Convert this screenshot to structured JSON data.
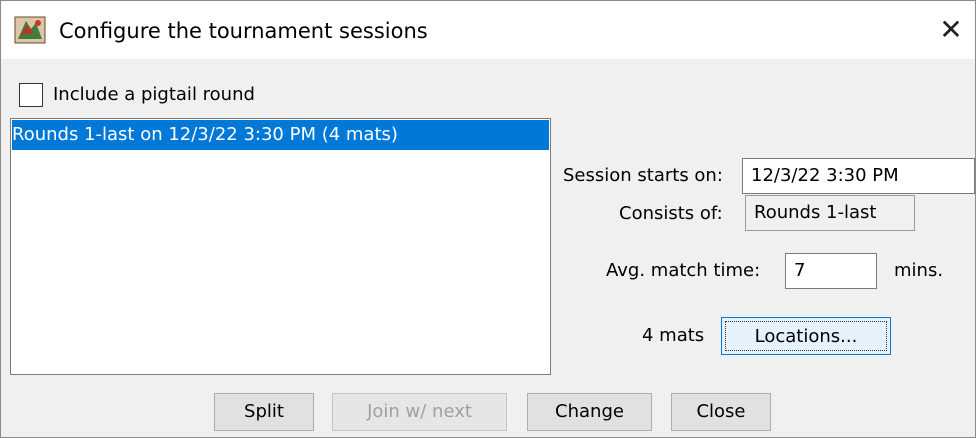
{
  "window": {
    "title": "Configure the tournament sessions",
    "close_glyph": "✕"
  },
  "pigtail": {
    "label": "Include a pigtail round",
    "checked": false
  },
  "sessions": {
    "items": [
      {
        "label": "Rounds 1-last on 12/3/22 3:30 PM (4 mats)",
        "selected": true
      }
    ]
  },
  "details": {
    "starts_label": "Session starts on:",
    "starts_value": "12/3/22 3:30 PM",
    "consists_label": "Consists of:",
    "consists_value": "Rounds 1-last",
    "match_time_label": "Avg. match time:",
    "match_time_value": "7",
    "match_time_unit": "mins.",
    "mats_label": "4 mats",
    "locations_button": "Locations..."
  },
  "buttons": {
    "split": "Split",
    "join_next": "Join w/ next",
    "change": "Change",
    "close": "Close"
  },
  "colors": {
    "selection": "#0078d7",
    "focus_border": "#0078d7"
  }
}
